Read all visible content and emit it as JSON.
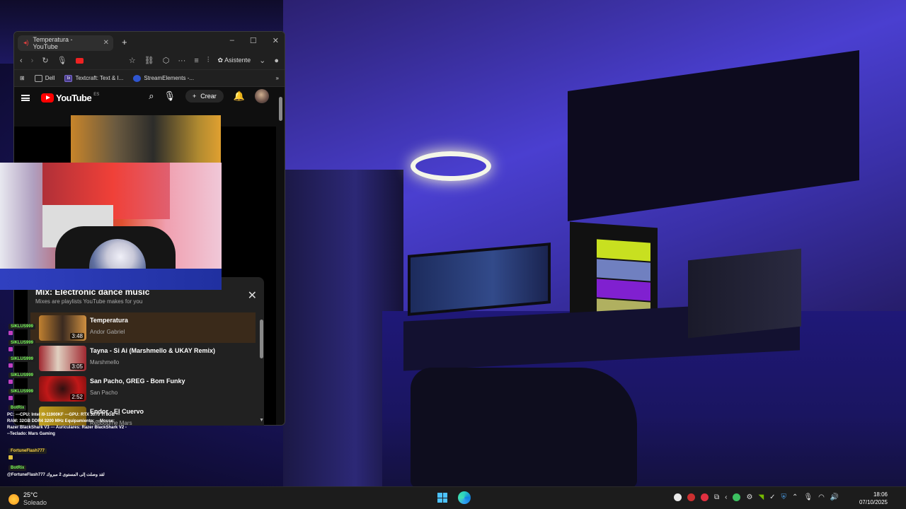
{
  "browser": {
    "tab_title": "Temperatura - YouTube",
    "new_tab": "+",
    "window_controls": [
      "–",
      "☐",
      "✕"
    ],
    "toolbar": {
      "asistente": "Asistente"
    },
    "favorites": [
      {
        "label": "Dell"
      },
      {
        "label": "Textcraft: Text & I..."
      },
      {
        "label": "StreamElements -..."
      }
    ],
    "favorites_more": "»"
  },
  "youtube": {
    "logo_text": "YouTube",
    "region": "ES",
    "create_label": "Crear",
    "mix": {
      "title": "Mix: Electronic dance music",
      "subtitle": "Mixes are playlists YouTube makes for you",
      "items": [
        {
          "title": "Temperatura",
          "artist": "Andor Gabriel",
          "duration": "3:48",
          "color": "#c08030"
        },
        {
          "title": "Tayna - Si Ai (Marshmello & UKAY Remix)",
          "artist": "Marshmello",
          "duration": "3:05",
          "color": "#a02830"
        },
        {
          "title": "San Pacho, GREG - Bom Funky",
          "artist": "San Pacho",
          "duration": "2:52",
          "color": "#c01818"
        },
        {
          "title": "Endor - El Cuervo",
          "artist": "Rebbourne Mars",
          "duration": "",
          "color": "#c0a020"
        }
      ]
    }
  },
  "chat": {
    "users": [
      {
        "name": "SIKLUS999"
      },
      {
        "name": "SIKLUS999"
      },
      {
        "name": "SIKLUS999"
      },
      {
        "name": "SIKLUS999"
      },
      {
        "name": "SIKLUS999"
      }
    ],
    "bot1": "BotRix",
    "bot1_message": "PC: ---CPU: Intel i9-11900KF ---GPU: RTX 3070 Ti 8GB ---RAM: 32GB DDR4 3200 MHz Equipamiento: ---Mouse: Razer BlackShark V3 --- Auriculares: Razer BlackShark V2 ---Teclado: Mars Gaming",
    "user2": "FortuneFlash777",
    "bot2": "BotRix",
    "bot2_message": "@FortuneFlash777 لقد وصلت إلى المستوى 2 مبروك"
  },
  "taskbar": {
    "temperature": "25°C",
    "weather": "Soleado",
    "time": "18:06",
    "date": "07/10/2025",
    "tray_colors": [
      "#e8e8e8",
      "#cc3030",
      "#e03040",
      "#d8d8d8",
      "#cfcfcf",
      "#3cc060",
      "#3080e0",
      "#40b040",
      "#4a9ae0"
    ]
  }
}
